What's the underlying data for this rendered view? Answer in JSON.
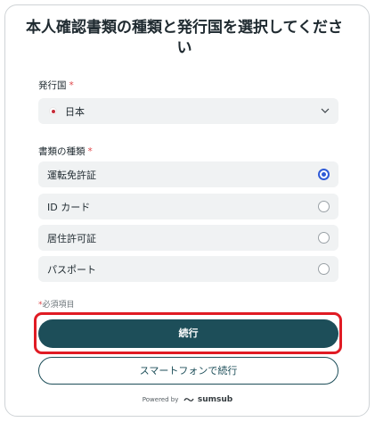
{
  "title": "本人確認書類の種類と発行国を選択してください",
  "country": {
    "label": "発行国",
    "required_mark": "*",
    "value": "日本",
    "flag_icon": "japan-flag-icon"
  },
  "doc_type": {
    "label": "書類の種類",
    "required_mark": "*",
    "options": [
      {
        "label": "運転免許証",
        "selected": true
      },
      {
        "label": "ID カード",
        "selected": false
      },
      {
        "label": "居住許可証",
        "selected": false
      },
      {
        "label": "パスポート",
        "selected": false
      }
    ]
  },
  "required_note": {
    "mark": "*",
    "text": "必須項目"
  },
  "buttons": {
    "continue": "続行",
    "continue_phone": "スマートフォンで続行"
  },
  "footer": {
    "powered_by": "Powered by",
    "brand": "sumsub"
  },
  "colors": {
    "accent": "#1d4e59",
    "radio_selected": "#2f5bd7",
    "required": "#e0484b",
    "highlight": "#e01b24"
  }
}
